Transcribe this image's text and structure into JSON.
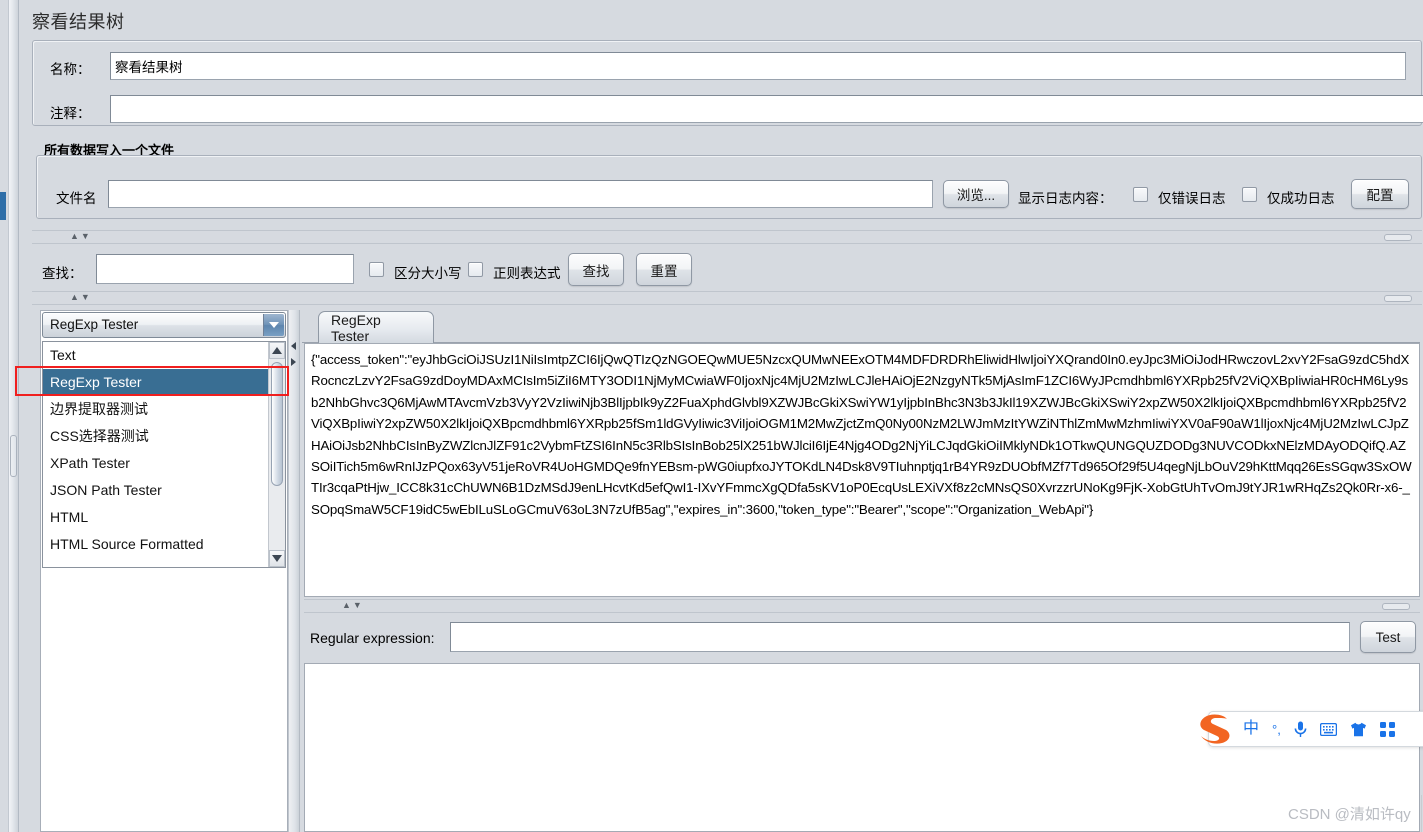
{
  "window": {
    "title": "察看结果树"
  },
  "fields": {
    "name_label": "名称：",
    "name_value": "察看结果树",
    "comment_label": "注释：",
    "comment_value": ""
  },
  "file_group": {
    "legend": "所有数据写入一个文件",
    "filename_label": "文件名",
    "filename_value": "",
    "browse_button": "浏览...",
    "log_display_label": "显示日志内容：",
    "errors_only_label": "仅错误日志",
    "errors_only_checked": false,
    "success_only_label": "仅成功日志",
    "success_only_checked": false,
    "configure_button": "配置"
  },
  "search_bar": {
    "search_label": "查找：",
    "search_value": "",
    "case_sensitive_label": "区分大小写",
    "case_sensitive_checked": false,
    "regex_label": "正则表达式",
    "regex_checked": false,
    "find_button": "查找",
    "reset_button": "重置"
  },
  "renderer": {
    "selected": "RegExp Tester",
    "options": [
      "Text",
      "RegExp Tester",
      "边界提取器测试",
      "CSS选择器测试",
      "XPath Tester",
      "JSON Path Tester",
      "HTML",
      "HTML Source Formatted"
    ],
    "selected_index": 1
  },
  "result_tabs": {
    "tabs": [
      {
        "label": "RegExp Tester",
        "active": true
      }
    ]
  },
  "response": {
    "text": "{\"access_token\":\"eyJhbGciOiJSUzI1NiIsImtpZCI6IjQwQTIzQzNGOEQwMUE5NzcxQUMwNEExOTM4MDFDRDRhEliwidHlwIjoiYXQrand0In0.eyJpc3MiOiJodHRwczovL2xvY2FsaG9zdC5hdXRocnczLzvY2FsaG9zdDoyMDAxMCIsIm5iZiI6MTY3ODI1NjMyMCwiaWF0IjoxNjc4MjU2MzIwLCJleHAiOjE2NzgyNTk5MjAsImF1ZCI6WyJPcmdhbml6YXRpb25fV2ViQXBpIiwiaHR0cHM6Ly9sb2NhbGhvc3Q6MjAwMTAvcmVzb3VyY2VzIiwiNjb3BlIjpbIk9yZ2FuaXphdGlvbl9XZWJBcGkiXSwiYW1yIjpbInBhc3N3b3JkIl19XZWJBcGkiXSwiY2xpZW50X2lkIjoiQXBpcmdhbml6YXRpb25fV2ViQXBpIiwiY2xpZW50X2lkIjoiQXBpcmdhbml6YXRpb25fSm1ldGVyIiwic3ViIjoiOGM1M2MwZjctZmQ0Ny00NzM2LWJmMzItYWZiNThlZmMwMzhmIiwiYXV0aF90aW1lIjoxNjc4MjU2MzIwLCJpZHAiOiJsb2NhbCIsInByZWZlcnJlZF91c2VybmFtZSI6InN5c3RlbSIsInBob25lX251bWJlciI6IjE4Njg4ODg2NjYiLCJqdGkiOiIMklyNDk1OTkwQUNGQUZDODg3NUVCODkxNElzMDAyODQifQ.AZSOiITich5m6wRnIJzPQox63yV51jeRoVR4UoHGMDQe9fnYEBsm-pWG0iupfxoJYTOKdLN4Dsk8V9TIuhnptjq1rB4YR9zDUObfMZf7Td965Of29f5U4qegNjLbOuV29hKttMqq26EsSGqw3SxOWTIr3cqaPtHjw_ICC8k31cChUWN6B1DzMSdJ9enLHcvtKd5efQwI1-IXvYFmmcXgQDfa5sKV1oP0EcqUsLEXiVXf8z2cMNsQS0XvrzzrUNoKg9FjK-XobGtUhTvOmJ9tYJR1wRHqZs2Qk0Rr-x6-_SOpqSmaW5CF19idC5wEbILuSLoGCmuV63oL3N7zUfB5ag\",\"expires_in\":3600,\"token_type\":\"Bearer\",\"scope\":\"Organization_WebApi\"}"
  },
  "regex_panel": {
    "regex_label": "Regular expression:",
    "regex_value": "",
    "test_button": "Test",
    "result_value": ""
  },
  "ime": {
    "logo": "sogou-logo",
    "items": [
      {
        "name": "chinese-mode-icon",
        "glyph": "中"
      },
      {
        "name": "punctuation-icon",
        "glyph": "°,"
      },
      {
        "name": "microphone-icon",
        "glyph": "mic"
      },
      {
        "name": "soft-keyboard-icon",
        "glyph": "keyboard"
      },
      {
        "name": "skin-icon",
        "glyph": "shirt"
      },
      {
        "name": "toolbox-icon",
        "glyph": "grid"
      }
    ]
  },
  "watermark": {
    "text": "CSDN @清如许qy"
  },
  "colors": {
    "background": "#d6dae0",
    "selection": "#396e93",
    "annotation": "#f01f1f",
    "ime_accent": "#1a73e8",
    "sogou_orange": "#f26522"
  }
}
